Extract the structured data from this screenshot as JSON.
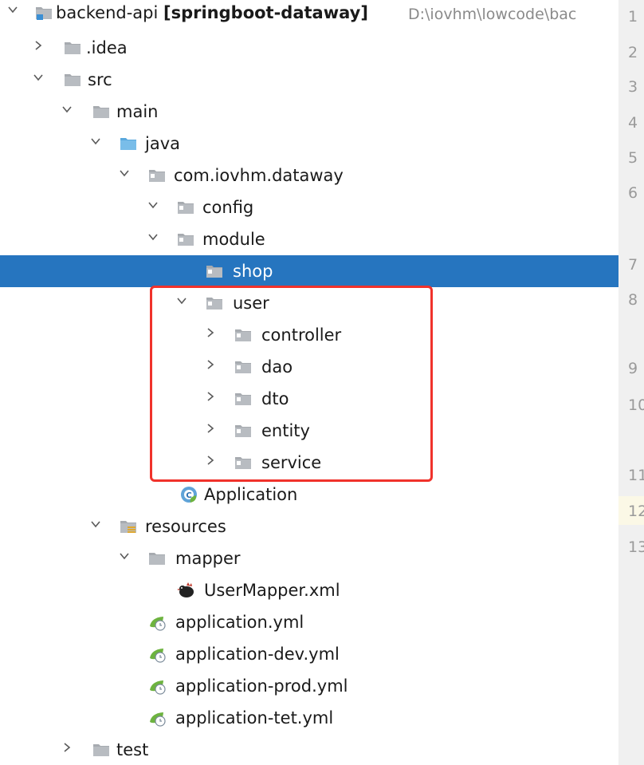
{
  "project": {
    "name": "backend-api",
    "module": "[springboot-dataway]",
    "path": "D:\\iovhm\\lowcode\\bac"
  },
  "tree": {
    "idea": ".idea",
    "src": "src",
    "main": "main",
    "java": "java",
    "package": "com.iovhm.dataway",
    "config": "config",
    "module": "module",
    "shop": "shop",
    "user": "user",
    "controller": "controller",
    "dao": "dao",
    "dto": "dto",
    "entity": "entity",
    "service": "service",
    "application_class": "Application",
    "resources": "resources",
    "mapper": "mapper",
    "user_mapper": "UserMapper.xml",
    "app_yml": "application.yml",
    "app_dev_yml": "application-dev.yml",
    "app_prod_yml": "application-prod.yml",
    "app_tet_yml": "application-tet.yml",
    "test": "test"
  },
  "selected_item": "shop",
  "highlighted_box": "user",
  "line_numbers": [
    "1",
    "2",
    "3",
    "4",
    "5",
    "6",
    "7",
    "8",
    "9",
    "10",
    "11",
    "12",
    "13"
  ],
  "colors": {
    "selection": "#2675bf",
    "highlight_box": "#f0322b",
    "folder": "#a7abb0",
    "source_folder": "#6cb7e6",
    "gutter": "#f0f0f0"
  },
  "icons": {
    "module_folder": "module-folder-icon",
    "folder": "folder-icon",
    "source_root": "source-root-folder-icon",
    "package": "package-icon",
    "resources": "resources-folder-icon",
    "spring_class": "spring-boot-class-icon",
    "mybatis": "mybatis-bird-icon",
    "spring_yml": "spring-yml-icon"
  }
}
